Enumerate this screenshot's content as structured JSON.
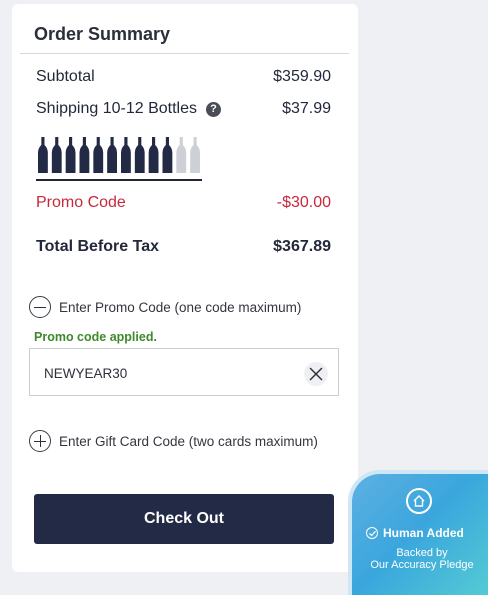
{
  "order_summary": {
    "title": "Order Summary",
    "subtotal_label": "Subtotal",
    "subtotal_value": "$359.90",
    "shipping_label": "Shipping 10-12 Bottles",
    "shipping_value": "$37.99",
    "bottles": {
      "total": 12,
      "filled": 10,
      "filled_color": "#222a45",
      "empty_color": "#cdd0d6"
    },
    "promo_label": "Promo Code",
    "promo_value": "-$30.00",
    "total_label": "Total Before Tax",
    "total_value": "$367.89"
  },
  "promo_section": {
    "toggle_label": "Enter Promo Code (one code maximum)",
    "toggle_icon": "minus-icon",
    "applied_message": "Promo code applied.",
    "code_value": "NEWYEAR30"
  },
  "gift_card_section": {
    "toggle_label": "Enter Gift Card Code (two cards maximum)",
    "toggle_icon": "plus-icon"
  },
  "checkout_label": "Check Out",
  "badge": {
    "title": "Human Added",
    "line1": "Backed by",
    "line2": "Our Accuracy Pledge"
  },
  "colors": {
    "accent_dark": "#222a45",
    "promo_red": "#c8283c",
    "success_green": "#3d8a2a"
  }
}
